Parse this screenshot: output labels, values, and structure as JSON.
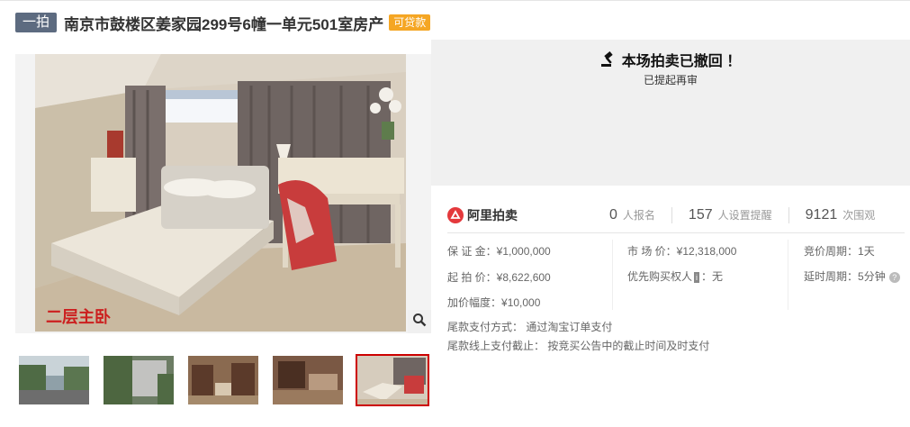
{
  "header": {
    "round_tag": "一拍",
    "title": "南京市鼓楼区姜家园299号6幢一单元501室房产",
    "loan_tag": "可贷款"
  },
  "gallery": {
    "main_caption": "二层主卧",
    "thumbnails": [
      "exterior-street",
      "exterior-trees",
      "living-room",
      "dining-room",
      "master-bedroom"
    ],
    "active_thumbnail": 5
  },
  "status": {
    "title": "本场拍卖已撤回 ！",
    "subtitle": "已提起再审"
  },
  "brand": {
    "name": "阿里拍卖"
  },
  "stats": [
    {
      "value": "0",
      "unit": "人报名"
    },
    {
      "value": "157",
      "unit": "人设置提醒"
    },
    {
      "value": "9121",
      "unit": "次围观"
    }
  ],
  "details": {
    "deposit_label": "保 证 金：",
    "deposit_value": "¥1,000,000",
    "start_price_label": "起 拍 价：",
    "start_price_value": "¥8,622,600",
    "increment_label": "加价幅度：",
    "increment_value": "¥10,000",
    "market_price_label": "市 场 价：",
    "market_price_value": "¥12,318,000",
    "priority_label": "优先购买权人",
    "priority_tag": "i",
    "priority_value": "：无",
    "bid_period_label": "竞价周期：",
    "bid_period_value": "1天",
    "delay_period_label": "延时周期：",
    "delay_period_value": "5分钟",
    "payment_method_label": "尾款支付方式：",
    "payment_method_value": "通过淘宝订单支付",
    "payment_deadline_label": "尾款线上支付截止：",
    "payment_deadline_value": "按竞买公告中的截止时间及时支付"
  },
  "colors": {
    "round_tag_bg": "#5d6b80",
    "loan_tag_bg": "#f5a623",
    "active_thumb_border": "#cc0000",
    "brand_red": "#e4393c"
  }
}
